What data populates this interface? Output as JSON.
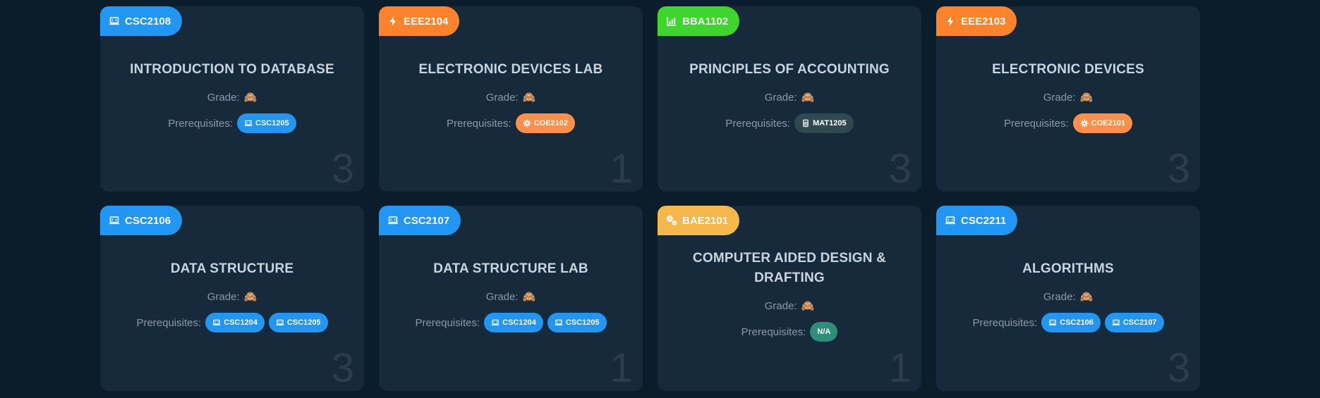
{
  "labels": {
    "grade": "Grade:",
    "prerequisites": "Prerequisites:"
  },
  "grade_emoji": "🙈",
  "colors": {
    "blue": "#2196f3",
    "orange": "#ff832b",
    "green": "#3ed62c",
    "yellow": "#f7b84b"
  },
  "courses": [
    {
      "code": "CSC2108",
      "icon": "laptop-icon",
      "color": "blue",
      "title": "INTRODUCTION TO DATABASE",
      "grade": "🙈",
      "credit": "3",
      "prereqs": [
        {
          "code": "CSC1205",
          "icon": "laptop-icon",
          "color": "blue"
        }
      ]
    },
    {
      "code": "EEE2104",
      "icon": "bolt-icon",
      "color": "orange",
      "title": "ELECTRONIC DEVICES LAB",
      "grade": "🙈",
      "credit": "1",
      "prereqs": [
        {
          "code": "COE2102",
          "icon": "gear-icon",
          "color": "orange"
        }
      ]
    },
    {
      "code": "BBA1102",
      "icon": "bar-chart-icon",
      "color": "green",
      "title": "PRINCIPLES OF ACCOUNTING",
      "grade": "🙈",
      "credit": "3",
      "prereqs": [
        {
          "code": "MAT1205",
          "icon": "calculator-icon",
          "color": "dark"
        }
      ]
    },
    {
      "code": "EEE2103",
      "icon": "bolt-icon",
      "color": "orange",
      "title": "ELECTRONIC DEVICES",
      "grade": "🙈",
      "credit": "3",
      "prereqs": [
        {
          "code": "COE2101",
          "icon": "gear-icon",
          "color": "orange"
        }
      ]
    },
    {
      "code": "CSC2106",
      "icon": "laptop-icon",
      "color": "blue",
      "title": "DATA STRUCTURE",
      "grade": "🙈",
      "credit": "3",
      "prereqs": [
        {
          "code": "CSC1204",
          "icon": "laptop-icon",
          "color": "blue"
        },
        {
          "code": "CSC1205",
          "icon": "laptop-icon",
          "color": "blue"
        }
      ]
    },
    {
      "code": "CSC2107",
      "icon": "laptop-icon",
      "color": "blue",
      "title": "DATA STRUCTURE LAB",
      "grade": "🙈",
      "credit": "1",
      "prereqs": [
        {
          "code": "CSC1204",
          "icon": "laptop-icon",
          "color": "blue"
        },
        {
          "code": "CSC1205",
          "icon": "laptop-icon",
          "color": "blue"
        }
      ]
    },
    {
      "code": "BAE2101",
      "icon": "gears-icon",
      "color": "yellow",
      "title": "COMPUTER AIDED DESIGN & DRAFTING",
      "grade": "🙈",
      "credit": "1",
      "prereqs": [
        {
          "code": "N/A",
          "icon": "",
          "color": "teal"
        }
      ]
    },
    {
      "code": "CSC2211",
      "icon": "laptop-icon",
      "color": "blue",
      "title": "ALGORITHMS",
      "grade": "🙈",
      "credit": "3",
      "prereqs": [
        {
          "code": "CSC2106",
          "icon": "laptop-icon",
          "color": "blue"
        },
        {
          "code": "CSC2107",
          "icon": "laptop-icon",
          "color": "blue"
        }
      ]
    }
  ]
}
